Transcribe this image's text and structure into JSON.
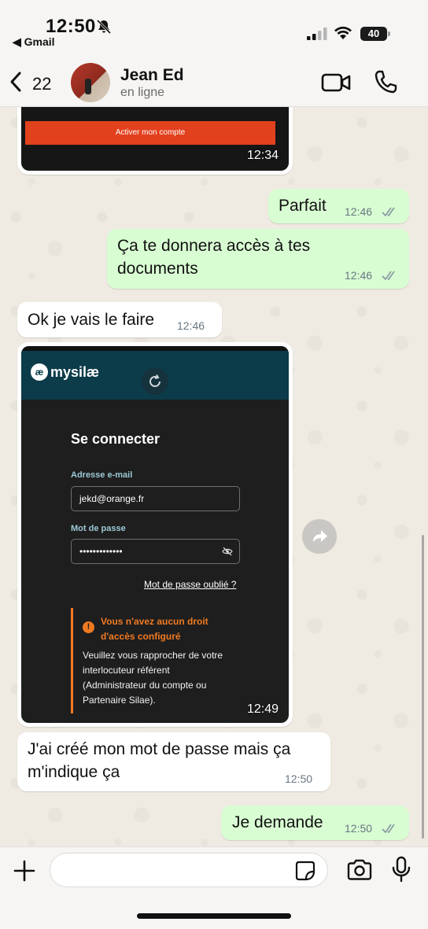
{
  "status_bar": {
    "time": "12:50",
    "back_app": "◀ Gmail",
    "battery": "40"
  },
  "header": {
    "back_count": "22",
    "contact_name": "Jean Ed",
    "contact_status": "en ligne"
  },
  "messages": [
    {
      "direction": "in",
      "type": "image",
      "button_text": "Activer mon compte",
      "time": "12:34"
    },
    {
      "direction": "out",
      "text": "Parfait",
      "time": "12:46",
      "read": true
    },
    {
      "direction": "out",
      "text_lines": [
        "Ça te donnera accès à tes",
        "documents"
      ],
      "time": "12:46",
      "read": true
    },
    {
      "direction": "in",
      "text": "Ok je vais le faire",
      "time": "12:46"
    },
    {
      "direction": "in",
      "type": "image",
      "time": "12:49",
      "screenshot": {
        "logo_mark": "æ",
        "logo_text": "mysilæ",
        "title": "Se connecter",
        "email_label": "Adresse e-mail",
        "email_value": "jekd@orange.fr",
        "password_label": "Mot de passe",
        "password_value": "•••••••••••••",
        "forgot_link": "Mot de passe oublié ?",
        "alert_icon": "!",
        "alert_title": "Vous n'avez aucun droit d'accès configuré",
        "alert_body": "Veuillez vous rapprocher de votre interlocuteur référent (Administrateur du compte ou Partenaire Silae)."
      }
    },
    {
      "direction": "in",
      "text_lines": [
        "J'ai créé mon mot de passe mais ça",
        "m'indique ça"
      ],
      "time": "12:50"
    },
    {
      "direction": "out",
      "text": "Je demande",
      "time": "12:50",
      "read": true
    }
  ],
  "icons": {
    "bell_muted": "bell-slash-icon",
    "signal": "signal-icon",
    "wifi": "wifi-icon",
    "back": "chevron-left-icon",
    "video": "video-camera-icon",
    "phone": "phone-icon",
    "forward": "forward-arrow-icon",
    "plus": "plus-icon",
    "sticker": "sticker-icon",
    "camera": "camera-icon",
    "mic": "microphone-icon",
    "read_ticks": "double-check-icon"
  },
  "colors": {
    "outgoing_bubble": "#d9fdd3",
    "incoming_bubble": "#ffffff",
    "chat_background": "#efeae2",
    "read_ticks": "#8696a0",
    "activate_button": "#e2411e",
    "alert_orange": "#f07a22"
  }
}
